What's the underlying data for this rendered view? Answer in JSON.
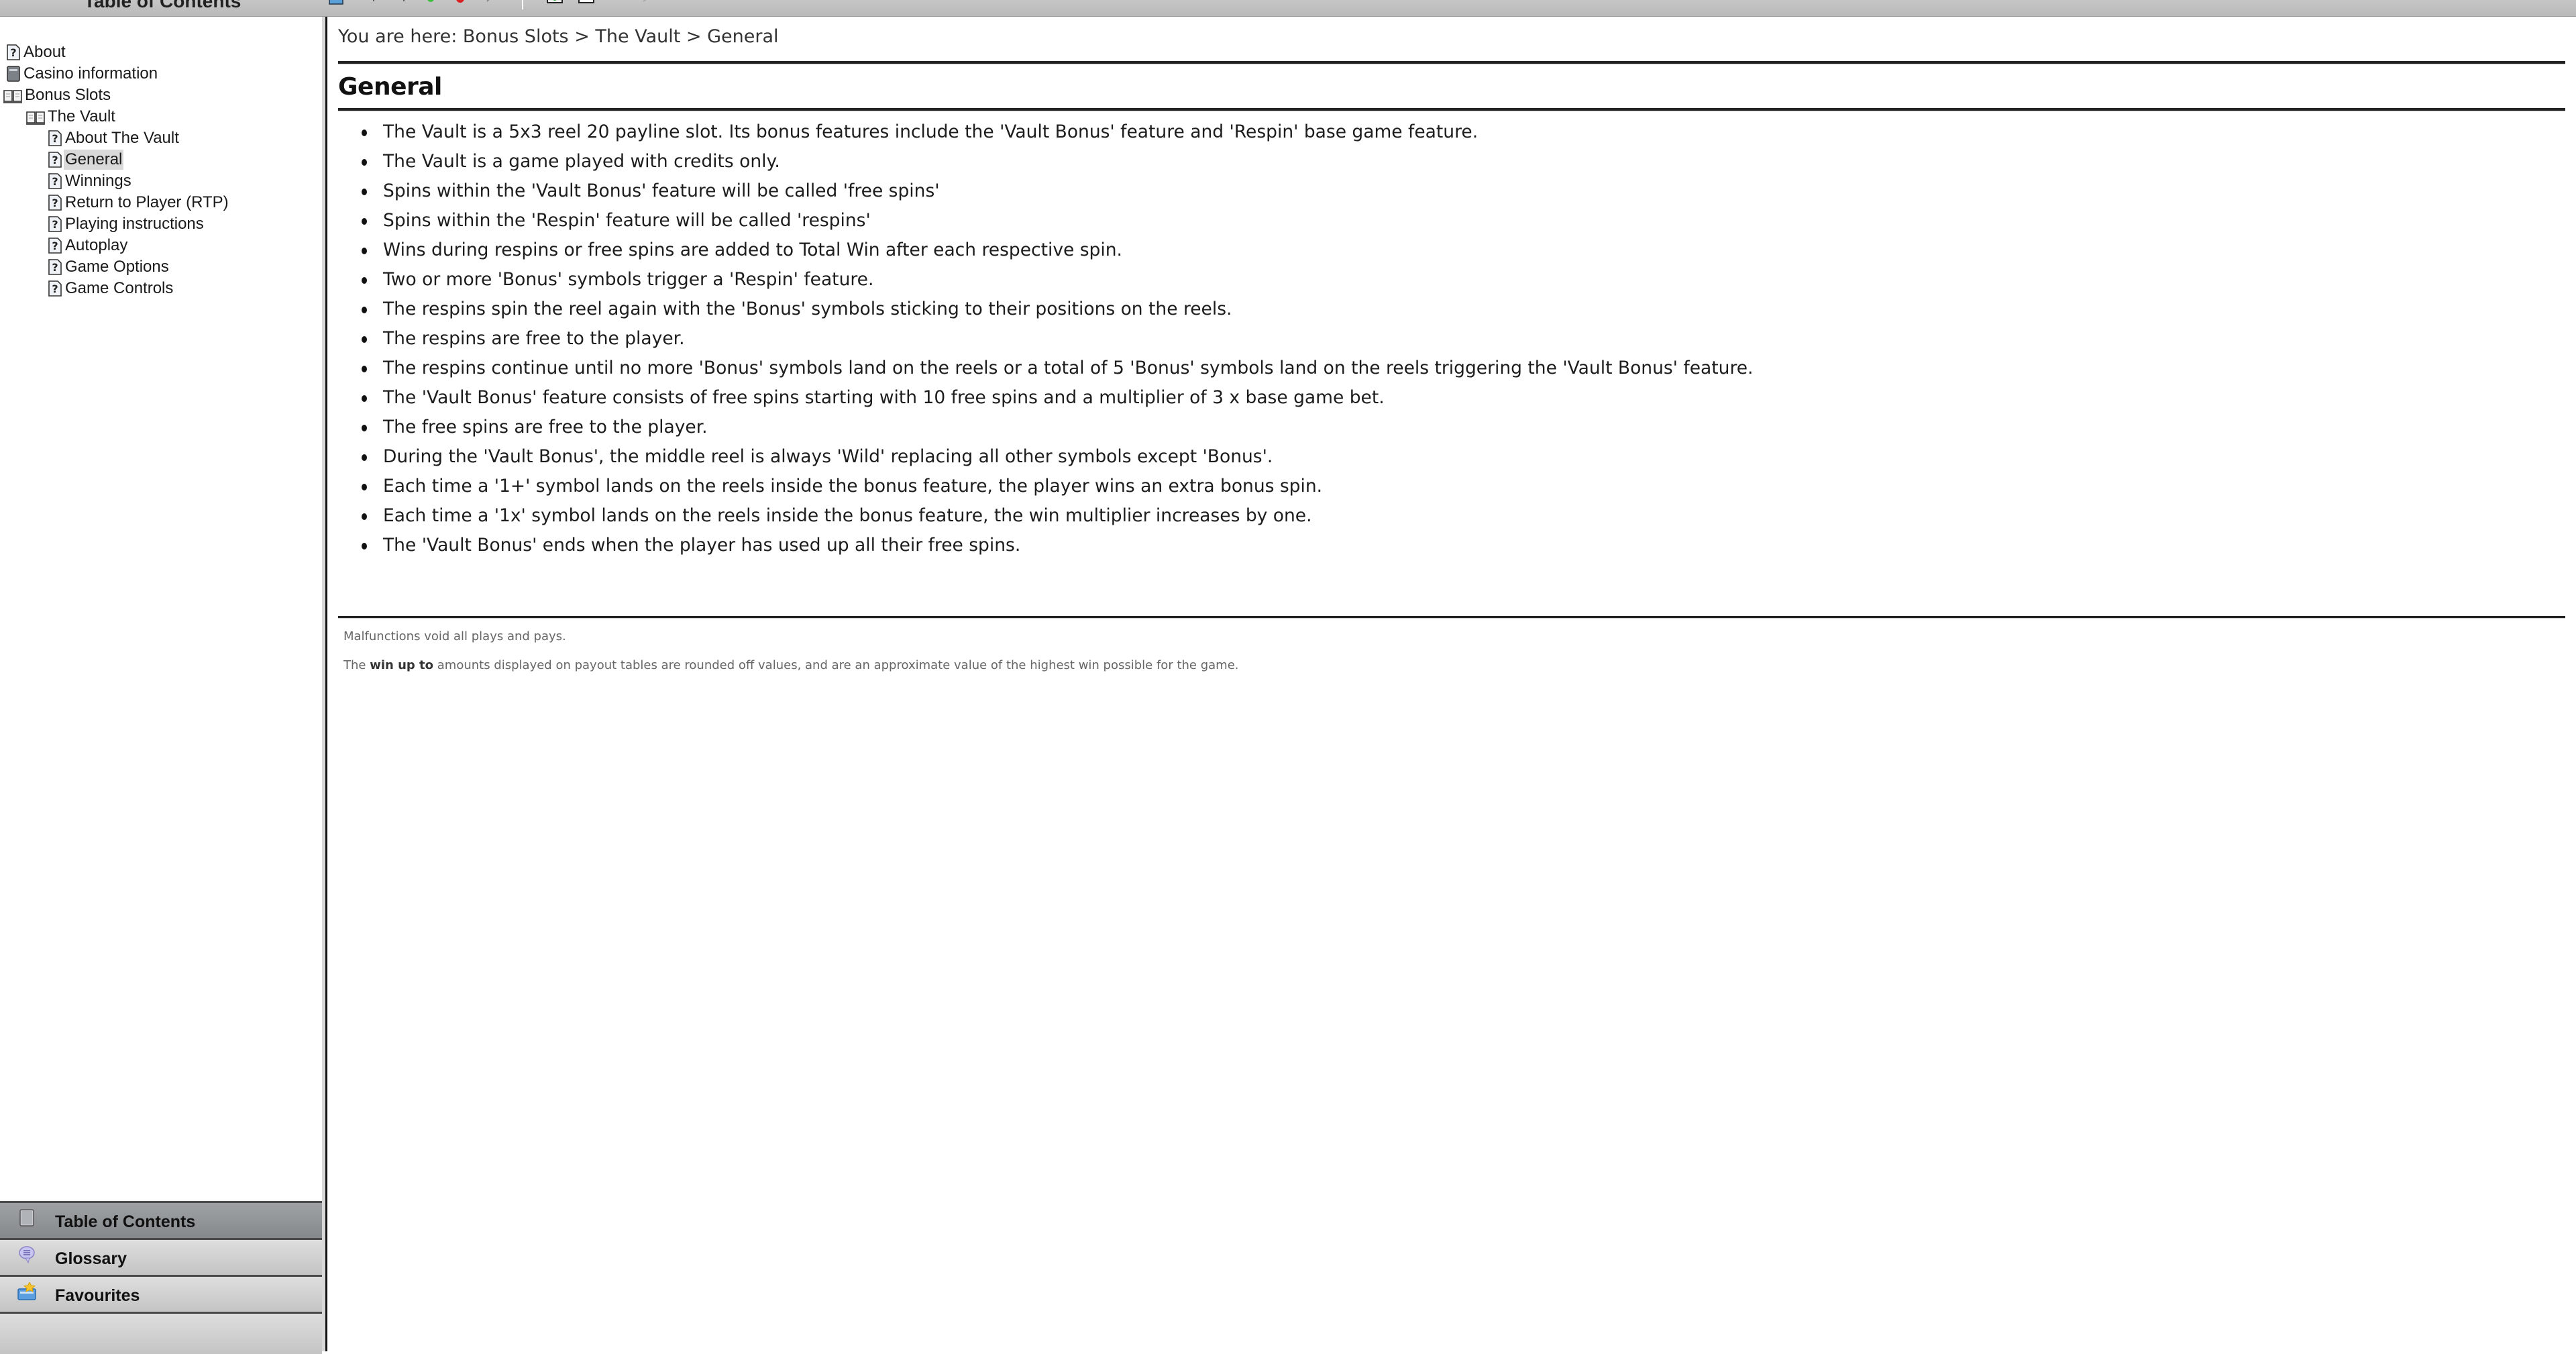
{
  "toolbar": {
    "header_title": "Table of Contents",
    "icons": [
      "toc-icon",
      "back-icon",
      "forward-icon",
      "green-dot-icon",
      "red-dot-icon",
      "edit-icon",
      "print-icon",
      "print-page-icon",
      "highlight-icon",
      "pin-icon"
    ]
  },
  "sidebar": {
    "toc": [
      {
        "label": "About",
        "icon": "help-page-icon",
        "level": 0
      },
      {
        "label": "Casino information",
        "icon": "closed-book-icon",
        "level": 0
      },
      {
        "label": "Bonus Slots",
        "icon": "open-book-icon",
        "level": 0
      },
      {
        "label": "The Vault",
        "icon": "open-book-icon",
        "level": 1
      },
      {
        "label": "About The Vault",
        "icon": "help-page-icon",
        "level": 2
      },
      {
        "label": "General",
        "icon": "help-page-icon",
        "level": 2,
        "selected": true
      },
      {
        "label": "Winnings",
        "icon": "help-page-icon",
        "level": 2
      },
      {
        "label": "Return to Player (RTP)",
        "icon": "help-page-icon",
        "level": 2
      },
      {
        "label": "Playing instructions",
        "icon": "help-page-icon",
        "level": 2
      },
      {
        "label": "Autoplay",
        "icon": "help-page-icon",
        "level": 2
      },
      {
        "label": "Game Options",
        "icon": "help-page-icon",
        "level": 2
      },
      {
        "label": "Game Controls",
        "icon": "help-page-icon",
        "level": 2
      }
    ],
    "panels": [
      {
        "label": "Table of Contents",
        "icon": "book-icon",
        "active": true
      },
      {
        "label": "Glossary",
        "icon": "speech-bubble-icon",
        "active": false
      },
      {
        "label": "Favourites",
        "icon": "favourites-folder-icon",
        "active": false
      }
    ]
  },
  "content": {
    "breadcrumb": "You are here: Bonus Slots > The Vault > General",
    "title": "General",
    "bullets": [
      "The Vault is a 5x3 reel 20 payline slot. Its bonus features include the 'Vault Bonus' feature and 'Respin' base game feature.",
      "The Vault is a game played with credits only.",
      "Spins within the 'Vault Bonus' feature will be called 'free spins'",
      "Spins within the 'Respin' feature will be called 'respins'",
      "Wins during respins or free spins are added to Total Win after each respective spin.",
      "Two or more 'Bonus' symbols trigger a 'Respin' feature.",
      "The respins spin the reel again with the 'Bonus' symbols sticking to their positions on the reels.",
      "The respins are free to the player.",
      "The respins continue until no more 'Bonus' symbols land on the reels or a total of 5 'Bonus' symbols land on the reels triggering the 'Vault Bonus' feature.",
      "The 'Vault Bonus' feature consists of free spins starting with 10 free spins and a multiplier of 3 x base game bet.",
      "The free spins are free to the player.",
      "During the 'Vault Bonus', the middle reel is always 'Wild' replacing all other symbols except 'Bonus'.",
      "Each time a '1+' symbol lands on the reels inside the bonus feature, the player wins an extra bonus spin.",
      "Each time a '1x' symbol lands on the reels inside the bonus feature, the win multiplier increases by one.",
      "The 'Vault Bonus' ends when the player has used up all their free spins."
    ],
    "footer": {
      "malfunction": "Malfunctions void all plays and pays.",
      "winupto_prefix": "The ",
      "winupto_bold": "win up to",
      "winupto_suffix": " amounts displayed on payout tables are rounded off values, and are an approximate value of the highest win possible for the game."
    }
  }
}
